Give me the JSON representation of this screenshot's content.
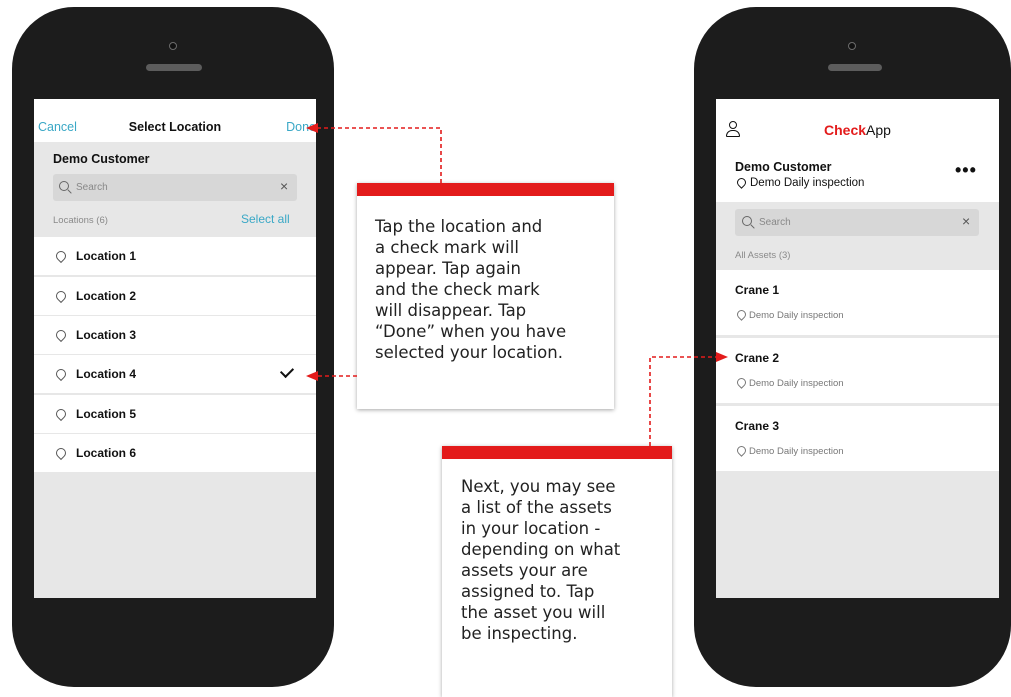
{
  "left_screen": {
    "header": {
      "cancel": "Cancel",
      "title": "Select Location",
      "done": "Done"
    },
    "customer": "Demo Customer",
    "search": {
      "placeholder": "Search",
      "clear": "×"
    },
    "section_label": "Locations (6)",
    "select_all": "Select all",
    "locations": [
      {
        "name": "Location 1",
        "checked": false
      },
      {
        "name": "Location 2",
        "checked": false
      },
      {
        "name": "Location 3",
        "checked": false
      },
      {
        "name": "Location 4",
        "checked": true
      },
      {
        "name": "Location 5",
        "checked": false
      },
      {
        "name": "Location 6",
        "checked": false
      }
    ]
  },
  "right_screen": {
    "app_title": {
      "brand": "Check",
      "rest": "App"
    },
    "customer": "Demo Customer",
    "subtitle": "Demo Daily inspection",
    "more": "•••",
    "search": {
      "placeholder": "Search",
      "clear": "×"
    },
    "section_label": "All Assets (3)",
    "assets": [
      {
        "name": "Crane 1",
        "location": "Demo Daily inspection"
      },
      {
        "name": "Crane 2",
        "location": "Demo Daily inspection"
      },
      {
        "name": "Crane 3",
        "location": "Demo Daily inspection"
      }
    ]
  },
  "callouts": {
    "select_location": "Tap the location and\na check mark will\nappear. Tap again\nand the check mark\nwill disappear. Tap\n“Done” when you have\nselected your location.",
    "assets": "Next, you may see\na list of the assets\nin your location -\ndepending on what\nassets your are\nassigned to. Tap\nthe asset you will\nbe inspecting."
  },
  "colors": {
    "accent_blue": "#3aa8c6",
    "callout_red": "#e31b1b",
    "phone_body": "#1c1c1c"
  }
}
